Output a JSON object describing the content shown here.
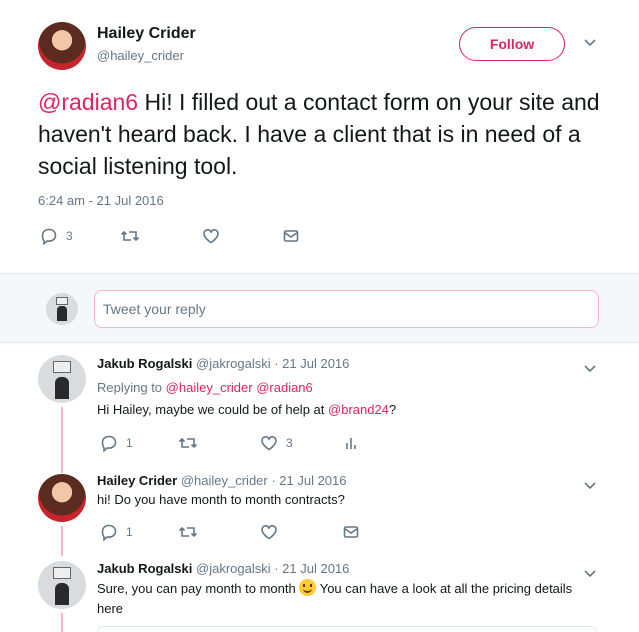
{
  "main_tweet": {
    "author_name": "Hailey Crider",
    "author_handle": "@hailey_crider",
    "follow_label": "Follow",
    "mention": "@radian6",
    "text": " Hi! I filled out a contact form on your site and haven't heard back. I have a client that is in need of a social listening tool.",
    "timestamp": "6:24 am - 21 Jul 2016",
    "reply_count": "3"
  },
  "reply_box": {
    "placeholder": "Tweet your reply"
  },
  "replies": [
    {
      "name": "Jakub Rogalski",
      "handle_date": "@jakrogalski · 21 Jul 2016",
      "replying_label": "Replying to",
      "replying_to_1": "@hailey_crider",
      "replying_to_2": "@radian6",
      "text_before": "Hi Hailey, maybe we could be of help at ",
      "text_mention": "@brand24",
      "text_after": "?",
      "reply_count": "1",
      "like_count": "3"
    },
    {
      "name": "Hailey Crider",
      "handle_date": "@hailey_crider · 21 Jul 2016",
      "text": "hi! Do you have month to month contracts?",
      "reply_count": "1"
    },
    {
      "name": "Jakub Rogalski",
      "handle_date": "@jakrogalski · 21 Jul 2016",
      "text_before": "Sure, you can pay month to month ",
      "text_after": " You can have a look at all the pricing details here"
    }
  ],
  "colors": {
    "accent": "#e0245e",
    "muted": "#657786",
    "thread_line": "#f2b8c6"
  },
  "icons": [
    "reply-icon",
    "retweet-icon",
    "like-icon",
    "message-icon",
    "analytics-icon",
    "chevron-down-icon"
  ]
}
